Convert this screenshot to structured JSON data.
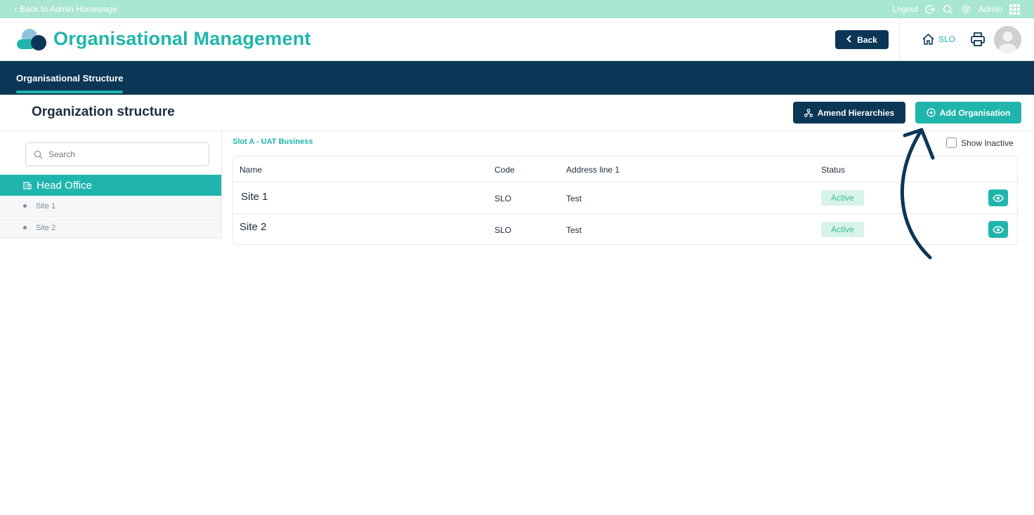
{
  "topbar": {
    "back_label": "Back to Admin Homepage",
    "logout_label": "Logout",
    "admin_label": "Admin"
  },
  "header": {
    "title": "Organisational Management",
    "back_button": "Back",
    "site_code": "SLO"
  },
  "nav": {
    "tabs": [
      {
        "label": "Organisational Structure",
        "active": true
      }
    ]
  },
  "page": {
    "title": "Organization structure",
    "amend_button": "Amend Hierarchies",
    "add_button": "Add Organisation"
  },
  "tree": {
    "search_placeholder": "Search",
    "root": "Head Office",
    "children": [
      "Site 1",
      "Site 2"
    ]
  },
  "content": {
    "breadcrumb": "Slot A - UAT Business",
    "show_inactive_label": "Show Inactive",
    "columns": [
      "Name",
      "Code",
      "Address line 1",
      "Status"
    ],
    "rows": [
      {
        "name": "Site 1",
        "code": "SLO",
        "address": "Test",
        "status": "Active"
      },
      {
        "name": "Site 2",
        "code": "SLO",
        "address": "Test",
        "status": "Active"
      }
    ]
  },
  "colors": {
    "teal": "#1fb5ac",
    "navy": "#0c3656",
    "topbar": "#a8e6d2",
    "active_badge_bg": "#d7f3ea"
  }
}
